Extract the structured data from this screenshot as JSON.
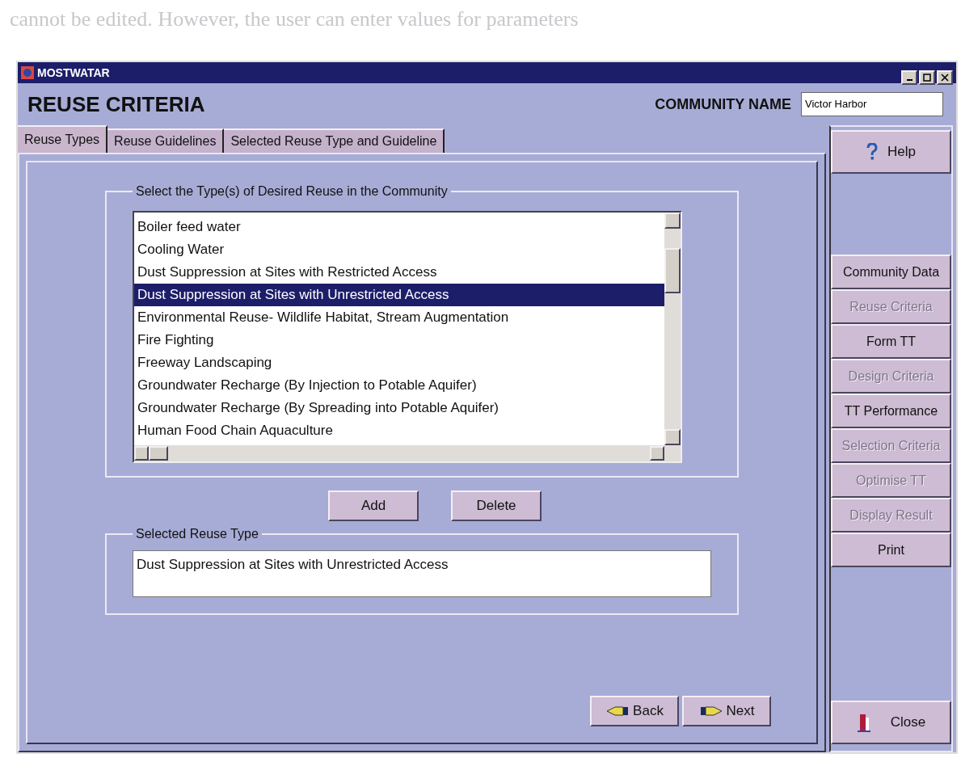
{
  "page_text": "cannot be edited. However, the user can enter values for parameters",
  "window": {
    "title": "MOSTWATAR"
  },
  "header": {
    "title": "REUSE CRITERIA",
    "community_label": "COMMUNITY NAME",
    "community_value": "Victor Harbor"
  },
  "tabs": [
    {
      "label": "Reuse Types",
      "selected": true
    },
    {
      "label": "Reuse Guidelines",
      "selected": false
    },
    {
      "label": "Selected Reuse Type and Guideline",
      "selected": false
    }
  ],
  "reuse_list": {
    "legend": "Select the Type(s) of Desired Reuse in the Community",
    "items": [
      {
        "label": "Boiler feed water",
        "selected": false
      },
      {
        "label": "Cooling Water",
        "selected": false
      },
      {
        "label": "Dust Suppression at Sites with Restricted Access",
        "selected": false
      },
      {
        "label": "Dust Suppression at Sites with Unrestricted Access",
        "selected": true
      },
      {
        "label": "Environmental Reuse- Wildlife Habitat, Stream Augmentation",
        "selected": false
      },
      {
        "label": "Fire Fighting",
        "selected": false
      },
      {
        "label": "Freeway Landscaping",
        "selected": false
      },
      {
        "label": "Groundwater Recharge (By Injection to Potable Aquifer)",
        "selected": false
      },
      {
        "label": "Groundwater Recharge (By Spreading into Potable Aquifer)",
        "selected": false
      },
      {
        "label": "Human Food Chain Aquaculture",
        "selected": false
      }
    ]
  },
  "actions": [
    "Add",
    "Delete"
  ],
  "selected_reuse": {
    "legend": "Selected Reuse Type",
    "value": "Dust Suppression at Sites with Unrestricted Access"
  },
  "nav_buttons": [
    {
      "label": "Back",
      "kind": "back"
    },
    {
      "label": "Next",
      "kind": "next"
    }
  ],
  "help": {
    "label": "Help"
  },
  "side_menu": [
    {
      "label": "Community Data",
      "disabled": false
    },
    {
      "label": "Reuse Criteria",
      "disabled": true
    },
    {
      "label": "Form TT",
      "disabled": false
    },
    {
      "label": "Design Criteria",
      "disabled": true
    },
    {
      "label": "TT Performance",
      "disabled": false
    },
    {
      "label": "Selection Criteria",
      "disabled": true
    },
    {
      "label": "Optimise TT",
      "disabled": true
    },
    {
      "label": "Display Result",
      "disabled": true
    },
    {
      "label": "Print",
      "disabled": false
    }
  ],
  "close": {
    "label": "Close"
  }
}
